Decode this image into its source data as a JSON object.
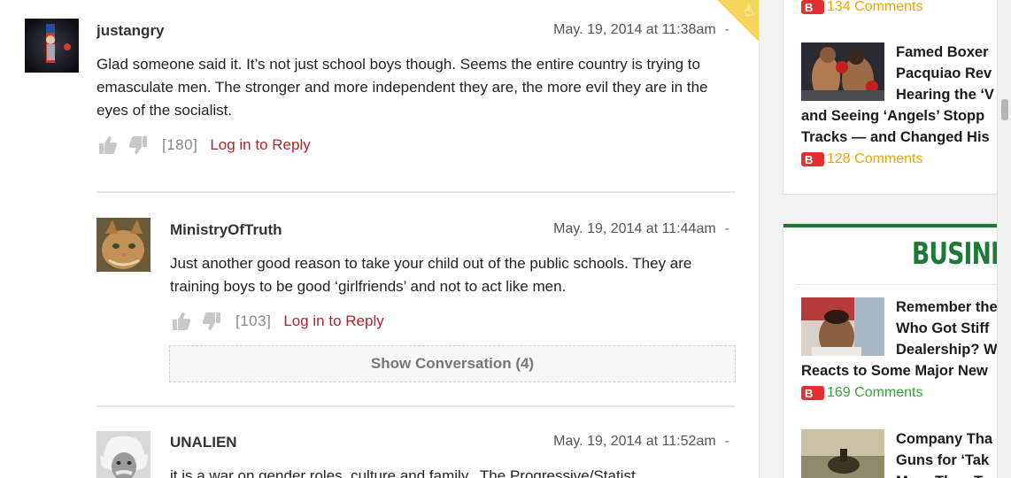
{
  "comments": [
    {
      "author": "justangry",
      "timestamp": "May. 19, 2014 at 11:38am",
      "dash": "-",
      "body": "Glad someone said it. It’s not just school boys though. Seems the entire country is trying to emasculate men. The stronger and more independent they are, the more evil they are in the eyes of the socialist.",
      "votes": "[180]",
      "reply_label": "Log in to Reply",
      "avatar": "flag-portrait-avatar"
    },
    {
      "author": "MinistryOfTruth",
      "timestamp": "May. 19, 2014 at 11:44am",
      "dash": "-",
      "body": "Just another good reason to take your child out of the public schools. They are training boys to be good ‘girlfriends’ and not to act like men.",
      "votes": "[103]",
      "reply_label": "Log in to Reply",
      "show_conversation": "Show Conversation (4)",
      "avatar": "cat-avatar"
    },
    {
      "author": "UNALIEN",
      "timestamp": "May. 19, 2014 at 11:52am",
      "dash": "-",
      "body": "it is a war on gender roles, culture and family.. The Progressive/Statist",
      "avatar": "einstein-avatar"
    }
  ],
  "sidebar": {
    "top_count": "134 Comments",
    "stories": [
      {
        "title_lines": [
          "Famed Boxer",
          "Pacquiao Rev",
          "Hearing the ‘V",
          "and Seeing ‘Angels’ Stopp",
          "Tracks — and Changed His"
        ],
        "comments": "128 Comments"
      },
      {
        "title_lines": [
          "Remember the",
          "Who Got Stiff",
          "Dealership? W",
          "Reacts to Some Major New"
        ],
        "comments": "169 Comments"
      },
      {
        "title_lines": [
          "Company Tha",
          "Guns for ‘Tak",
          "More Than T"
        ]
      }
    ],
    "section_title": "BUSINES"
  },
  "colors": {
    "link_red": "#b2242c",
    "comments_orange": "#e9a800",
    "comments_green": "#3aa13a",
    "section_green": "#1d7a36"
  }
}
